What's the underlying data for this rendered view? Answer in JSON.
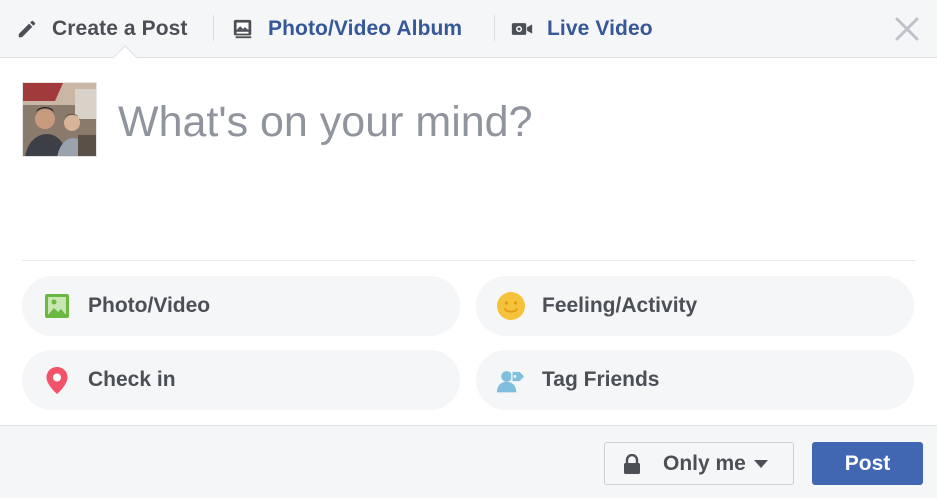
{
  "header": {
    "tabs": [
      {
        "label": "Create a Post",
        "icon": "pencil-icon"
      },
      {
        "label": "Photo/Video Album",
        "icon": "album-icon"
      },
      {
        "label": "Live Video",
        "icon": "video-camera-icon"
      }
    ],
    "close_icon": "close-icon"
  },
  "composer": {
    "placeholder": "What's on your mind?",
    "value": ""
  },
  "actions": [
    {
      "label": "Photo/Video",
      "icon": "photo-icon",
      "color": "#6bb843"
    },
    {
      "label": "Feeling/Activity",
      "icon": "smiley-icon",
      "color": "#f5c33b"
    },
    {
      "label": "Check in",
      "icon": "location-pin-icon",
      "color": "#f35369"
    },
    {
      "label": "Tag Friends",
      "icon": "tag-friends-icon",
      "color": "#7fbfdd"
    }
  ],
  "footer": {
    "privacy_label": "Only me",
    "post_label": "Post"
  },
  "colors": {
    "brand_blue": "#4267b2",
    "link_blue": "#365899",
    "muted_text": "#4b4f56",
    "placeholder": "#90949c",
    "panel_bg": "#f5f6f7"
  }
}
